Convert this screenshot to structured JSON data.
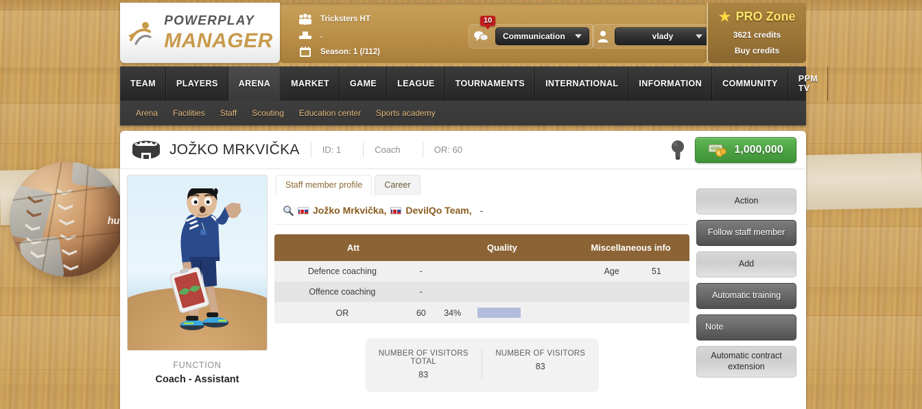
{
  "header": {
    "logo": {
      "line1": "POWERPLAY",
      "line2": "MANAGER",
      "icon": "ppm-logo-icon"
    },
    "team": {
      "name": "Tricksters HT",
      "rank": ".",
      "season": "Season: 1 (/112)",
      "icons": [
        "team-people-icon",
        "podium-icon",
        "calendar-icon"
      ]
    },
    "communication": {
      "label": "Communication",
      "badge": "10",
      "icon": "chat-bubbles-icon"
    },
    "user": {
      "name": "vlady",
      "icon": "user-avatar-icon"
    },
    "pro_zone": {
      "title": "PRO Zone",
      "credits": "3621 credits",
      "buy": "Buy credits",
      "icon": "star-icon"
    }
  },
  "nav": {
    "items": [
      {
        "label": "TEAM",
        "active": false
      },
      {
        "label": "PLAYERS",
        "active": false
      },
      {
        "label": "ARENA",
        "active": true
      },
      {
        "label": "MARKET",
        "active": false
      },
      {
        "label": "GAME",
        "active": false
      },
      {
        "label": "LEAGUE",
        "active": false
      },
      {
        "label": "TOURNAMENTS",
        "active": false
      },
      {
        "label": "INTERNATIONAL",
        "active": false
      },
      {
        "label": "INFORMATION",
        "active": false
      },
      {
        "label": "COMMUNITY",
        "active": false
      },
      {
        "label": "PPM TV",
        "active": false
      }
    ],
    "sub_items": [
      {
        "label": "Arena"
      },
      {
        "label": "Facilities"
      },
      {
        "label": "Staff"
      },
      {
        "label": "Scouting"
      },
      {
        "label": "Education center"
      },
      {
        "label": "Sports academy"
      }
    ]
  },
  "page_head": {
    "icon": "stadium-icon",
    "title": "JOŽKO MRKVIČKA",
    "meta": [
      "ID: 1",
      "Coach",
      "OR: 60"
    ],
    "bulb_icon": "lightbulb-icon",
    "money": {
      "amount": "1,000,000",
      "icon": "cash-icon"
    }
  },
  "avatar": {
    "image": "coach-avatar-image",
    "function_label": "FUNCTION",
    "function_value": "Coach - Assistant"
  },
  "tabs": [
    {
      "label": "Staff member profile",
      "active": true
    },
    {
      "label": "Career",
      "active": false
    }
  ],
  "breadcrumb": {
    "search_icon": "magnifier-icon",
    "person_flag": "slovakia-flag-icon",
    "person": "Jožko Mrkvička,",
    "team_flag": "slovakia-flag-icon",
    "team": "DevilQo Team,",
    "extra": "-"
  },
  "table": {
    "headers": [
      "Att",
      "Quality",
      "Miscellaneous info"
    ],
    "rows": [
      {
        "label": "Defence coaching",
        "value": "-",
        "pct": "",
        "bar_pct": 0,
        "misc_label": "Age",
        "misc_value": "51"
      },
      {
        "label": "Offence coaching",
        "value": "-",
        "pct": "",
        "bar_pct": 0,
        "misc_label": "",
        "misc_value": ""
      },
      {
        "label": "OR",
        "value": "60",
        "pct": "34%",
        "bar_pct": 34,
        "misc_label": "",
        "misc_value": ""
      }
    ]
  },
  "visitors": [
    {
      "label": "NUMBER OF VISITORS TOTAL",
      "value": "83"
    },
    {
      "label": "NUMBER OF VISITORS",
      "value": "83"
    }
  ],
  "actions": [
    {
      "label": "Action",
      "style": "light"
    },
    {
      "label": "Follow staff member",
      "style": "dark"
    },
    {
      "label": "Add",
      "style": "light"
    },
    {
      "label": "Automatic training",
      "style": "dark"
    },
    {
      "label": "Note",
      "style": "dark"
    },
    {
      "label": "Automatic contract extension",
      "style": "light"
    }
  ],
  "colors": {
    "accent_gold": "#c99a4b",
    "header_panel": "#bb8f47",
    "nav_dark": "#2f2f2f",
    "table_header": "#8b6334",
    "money_green": "#4da343",
    "badge_red": "#c01b1b",
    "quality_bar": "#b3bcda",
    "pro_text": "#ffe46a"
  }
}
